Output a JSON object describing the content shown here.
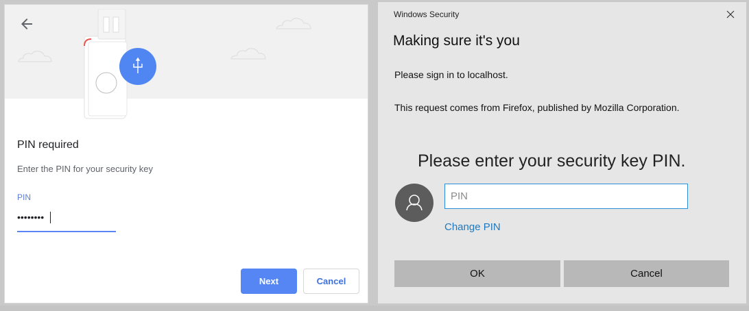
{
  "left_dialog": {
    "title": "PIN required",
    "description": "Enter the PIN for your security key",
    "field_label": "PIN",
    "field_value": "••••••••",
    "next_label": "Next",
    "cancel_label": "Cancel",
    "colors": {
      "accent": "#5586f4",
      "hero_bg": "#f1f1f1"
    }
  },
  "right_dialog": {
    "window_title": "Windows Security",
    "heading": "Making sure it's you",
    "signin_text": "Please sign in to localhost.",
    "request_text": "This request comes from Firefox, published by Mozilla Corporation.",
    "prompt": "Please enter your security key PIN.",
    "pin_placeholder": "PIN",
    "change_pin_label": "Change PIN",
    "ok_label": "OK",
    "cancel_label": "Cancel",
    "icons": {
      "close": "close-icon",
      "avatar": "user-icon"
    },
    "colors": {
      "link": "#1e78bf",
      "input_border": "#2b8fd6",
      "button_bg": "#b8b8b8"
    }
  }
}
